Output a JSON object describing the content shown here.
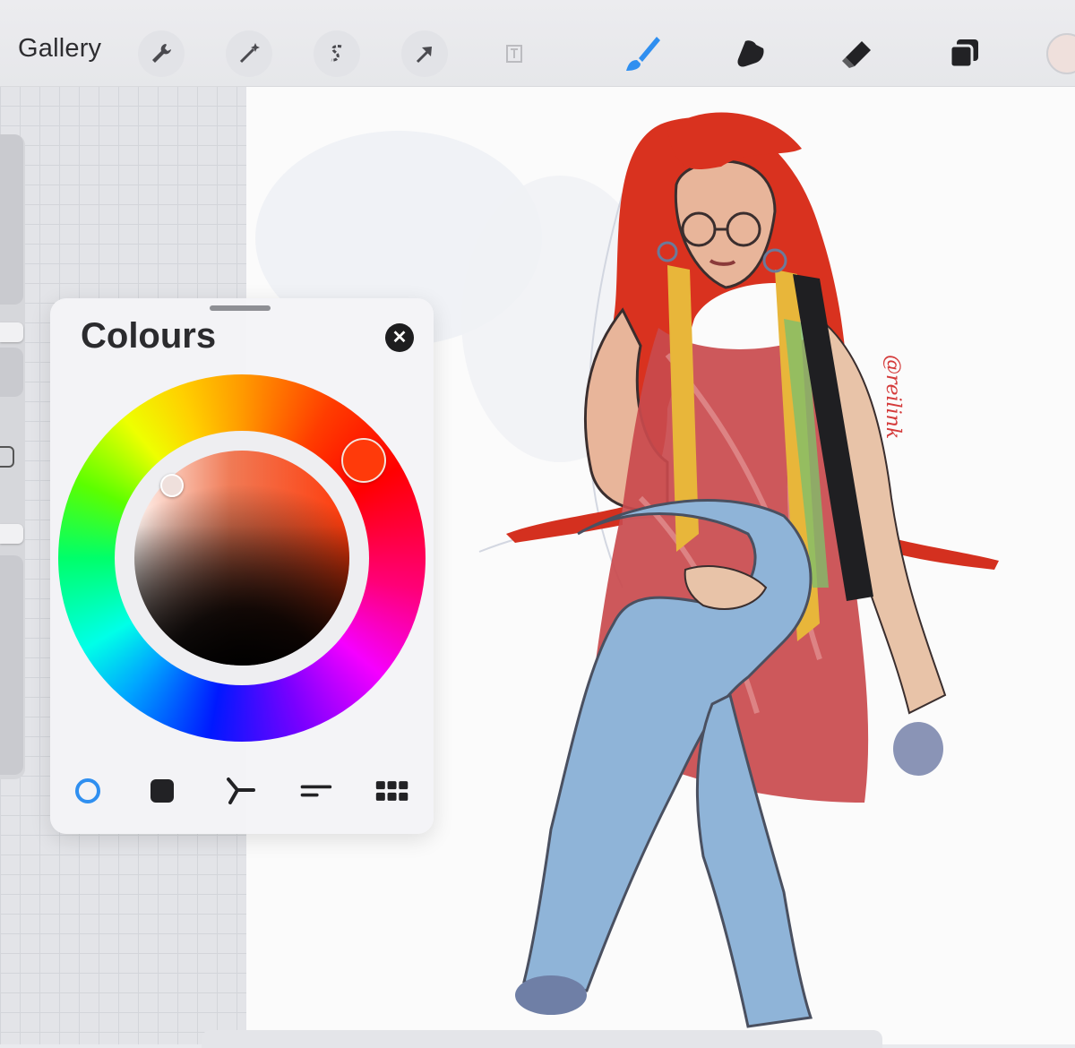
{
  "toolbar": {
    "gallery_label": "Gallery",
    "left_tools": [
      {
        "name": "actions",
        "icon": "wrench-icon"
      },
      {
        "name": "adjustments",
        "icon": "magic-wand-icon"
      },
      {
        "name": "selection",
        "icon": "selection-s-icon"
      },
      {
        "name": "transform",
        "icon": "arrow-cursor-icon"
      },
      {
        "name": "text",
        "icon": "text-frame-icon"
      }
    ],
    "right_tools": [
      {
        "name": "brush",
        "icon": "brush-icon",
        "active": true,
        "color": "#2f8ff0"
      },
      {
        "name": "smudge",
        "icon": "smudge-finger-icon"
      },
      {
        "name": "eraser",
        "icon": "eraser-icon"
      },
      {
        "name": "layers",
        "icon": "layers-icon"
      },
      {
        "name": "current-colour",
        "icon": "colour-swatch-icon"
      }
    ]
  },
  "colours_panel": {
    "title": "Colours",
    "close_icon": "close-icon",
    "current_colour": "#ff3a0a",
    "selected_shade": "#efe0dc",
    "modes": [
      {
        "name": "disc",
        "icon": "disc-mode-icon",
        "active": true
      },
      {
        "name": "classic",
        "icon": "classic-mode-icon",
        "active": false
      },
      {
        "name": "harmony",
        "icon": "harmony-mode-icon",
        "active": false
      },
      {
        "name": "value",
        "icon": "value-mode-icon",
        "active": false
      },
      {
        "name": "palettes",
        "icon": "palettes-mode-icon",
        "active": false
      }
    ]
  },
  "canvas": {
    "signature": "@reilink",
    "accent_colors": {
      "hair": "#d9321f",
      "dress": "#c94a4d",
      "jeans": "#8fb4d8",
      "skin": "#e8b59a",
      "scarf": "#e8b63a"
    }
  }
}
